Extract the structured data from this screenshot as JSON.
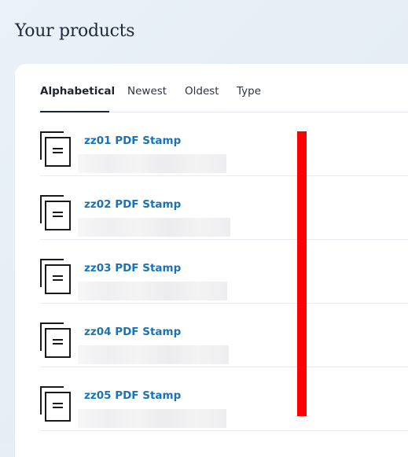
{
  "page": {
    "title": "Your products"
  },
  "tabs": [
    {
      "label": "Alphabetical",
      "active": true
    },
    {
      "label": "Newest",
      "active": false
    },
    {
      "label": "Oldest",
      "active": false
    },
    {
      "label": "Type",
      "active": false
    }
  ],
  "products": [
    {
      "name": "zz01 PDF Stamp",
      "icon": "document-stack-icon"
    },
    {
      "name": "zz02 PDF Stamp",
      "icon": "document-stack-icon"
    },
    {
      "name": "zz03 PDF Stamp",
      "icon": "document-stack-icon"
    },
    {
      "name": "zz04 PDF Stamp",
      "icon": "document-stack-icon"
    },
    {
      "name": "zz05 PDF Stamp",
      "icon": "document-stack-icon"
    }
  ],
  "colors": {
    "link": "#1a73b8",
    "text": "#1d2530",
    "annotation": "#ff0000",
    "background": "#e7eef6"
  }
}
